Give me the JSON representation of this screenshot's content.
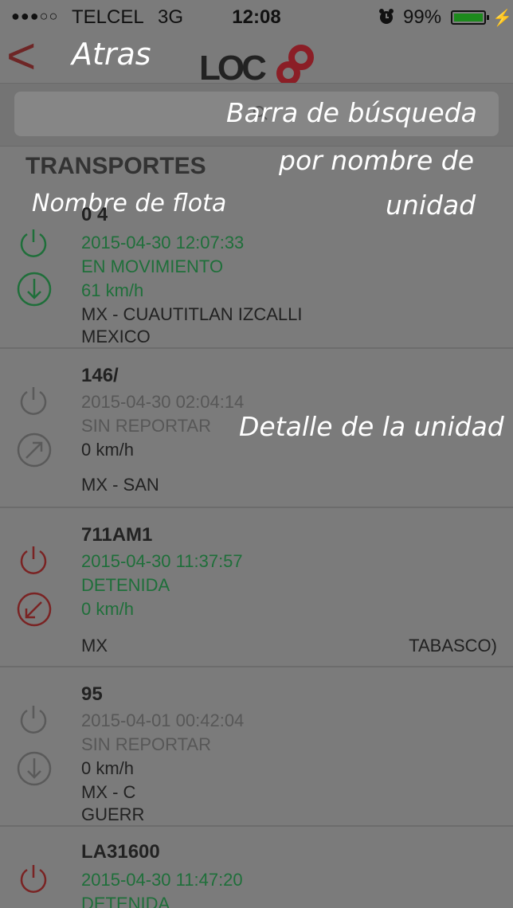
{
  "status_bar": {
    "signal": "●●●○○",
    "carrier": "TELCEL",
    "network": "3G",
    "time": "12:08",
    "battery_pct": "99%",
    "battery_level": 0.99,
    "colors": {
      "battery": "#1d8a1d"
    }
  },
  "nav": {
    "back_label": "Atras",
    "logo_text": "LOC8",
    "colors": {
      "chevron": "#6e2626",
      "logo_red": "#8b1e26",
      "logo_dark": "#222222"
    }
  },
  "annotations": {
    "search_1": "Barra de búsqueda",
    "search_2": "por nombre de",
    "search_3": "unidad",
    "fleet_name": "Nombre de flota",
    "unit_detail": "Detalle de la unidad"
  },
  "section_title": "TRANSPORTES",
  "units": [
    {
      "name": "0 4",
      "datetime": "2015-04-30 12:07:33",
      "status": "EN MOVIMIENTO",
      "speed": "61  km/h",
      "location_1": "MX - CUAUTITLAN IZCALLI",
      "location_2": "MEXICO",
      "location_right": "",
      "power_icon": "power-icon",
      "direction_icon": "arrow-down-icon",
      "color": "#1f6f3a"
    },
    {
      "name": "146/",
      "datetime": "2015-04-30 02:04:14",
      "status": "SIN REPORTAR",
      "speed": "0  km/h",
      "location_1": "MX - SAN",
      "location_2": "",
      "location_right": "",
      "power_icon": "power-icon",
      "direction_icon": "arrow-up-right-icon",
      "color": "#595959"
    },
    {
      "name": "711AM1",
      "datetime": "2015-04-30 11:37:57",
      "status": "DETENIDA",
      "speed": "0  km/h",
      "location_1": "MX",
      "location_2": "",
      "location_right": "TABASCO)",
      "power_icon": "power-icon",
      "direction_icon": "arrow-down-left-icon",
      "color": "#7a2323"
    },
    {
      "name": "95",
      "datetime": "2015-04-01 00:42:04",
      "status": "SIN REPORTAR",
      "speed": "0  km/h",
      "location_1": "MX - C",
      "location_2": "GUERR",
      "location_right": "",
      "power_icon": "power-icon",
      "direction_icon": "arrow-down-icon",
      "color": "#595959"
    },
    {
      "name": "LA31600",
      "datetime": "2015-04-30 11:47:20",
      "status": "DETENIDA",
      "speed": "",
      "location_1": "",
      "location_2": "",
      "location_right": "",
      "power_icon": "power-icon",
      "direction_icon": "",
      "color": "#7a2323"
    }
  ]
}
